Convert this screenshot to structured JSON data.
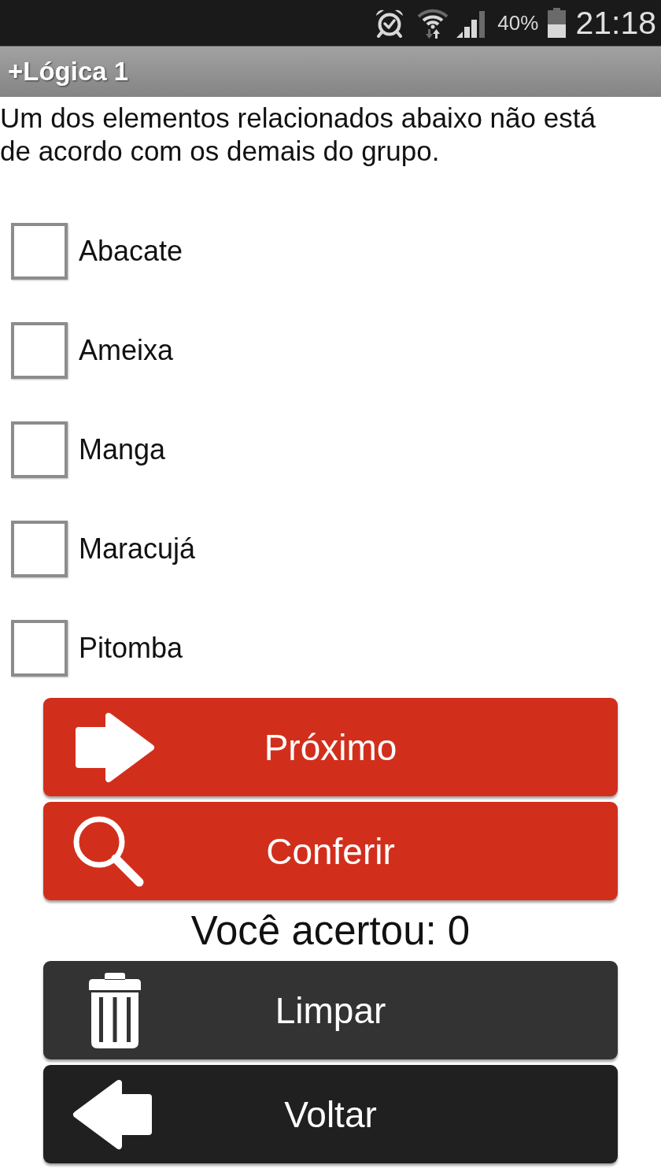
{
  "status_bar": {
    "battery_percent": "40%",
    "time": "21:18"
  },
  "title_bar": {
    "title": "+Lógica 1"
  },
  "question": "Um dos elementos relacionados abaixo não está de acordo com os demais do grupo.",
  "options": [
    {
      "label": "Abacate",
      "checked": false
    },
    {
      "label": "Ameixa",
      "checked": false
    },
    {
      "label": "Manga",
      "checked": false
    },
    {
      "label": "Maracujá",
      "checked": false
    },
    {
      "label": "Pitomba",
      "checked": false
    }
  ],
  "actions": [
    {
      "kind": "next",
      "label": "Próximo"
    },
    {
      "kind": "check",
      "label": "Conferir"
    }
  ],
  "score": "Você acertou: 0",
  "bottom_actions": [
    {
      "kind": "clear",
      "label": "Limpar"
    },
    {
      "kind": "back",
      "label": "Voltar"
    }
  ]
}
